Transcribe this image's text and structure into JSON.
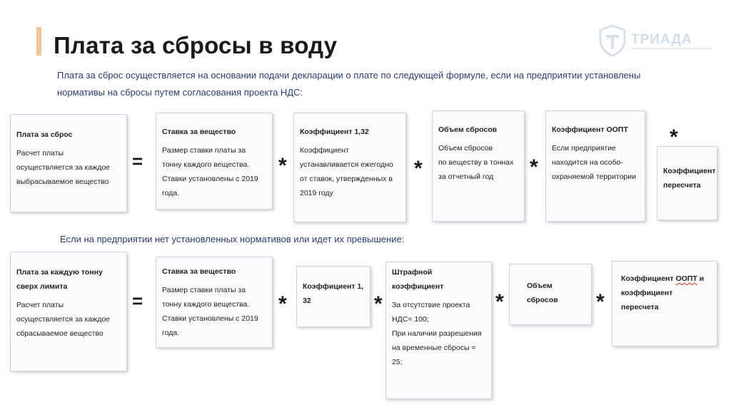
{
  "title": "Плата за сбросы в воду",
  "logo": {
    "text": "ТРИАДА",
    "icon": "shield-t-icon"
  },
  "intro": "Плата за сброс осуществляется на основании подачи декларации о плате по следующей формуле, если на предприятии установлены нормативы на сбросы путем согласования проекта НДС:",
  "subheading": "Если на предприятии нет установленных нормативов или идет их превышение:",
  "operators": {
    "eq": "=",
    "mul": "*"
  },
  "row1": [
    {
      "title": "Плата за сброс",
      "body": "Расчет платы осуществляется за каждое выбрасываемое вещество"
    },
    {
      "title": "Ставка за вещество",
      "body": "Размер ставки платы за тонну каждого вещества. Ставки установлены с 2019 года."
    },
    {
      "title": "Коэффициент 1,32",
      "body": "Коэффициент устанавливается ежегодно от ставок, утвержденных в 2019 году"
    },
    {
      "title": "Объем сбросов",
      "body": "Объем сбросов\nпо  веществу в тоннах за отчетный год"
    },
    {
      "title": "Коэффициент ООПТ",
      "body": "Если предприятие находится на особо-охраняемой территории"
    },
    {
      "title": "Коэффициент пересчета",
      "body": ""
    }
  ],
  "row2": [
    {
      "title": "Плата за каждую тонну сверх лимита",
      "body": "Расчет платы осуществляется за каждое сбрасываемое вещество"
    },
    {
      "title": "Ставка за вещество",
      "body": "Размер ставки платы за тонну каждого вещества. Ставки установлены с 2019 года."
    },
    {
      "title": "Коэффициент 1, 32",
      "body": ""
    },
    {
      "title": "Штрафной коэффициент",
      "body": "За отсутствие проекта НДС= 100;\nПри наличии разрешения на временные сбросы = 25;"
    },
    {
      "title": "Объем сбросов",
      "body": ""
    },
    {
      "title_a": "Коэффициент ",
      "title_b": "ООПТ",
      "title_c": " и коэффициент пересчета",
      "body": ""
    }
  ]
}
